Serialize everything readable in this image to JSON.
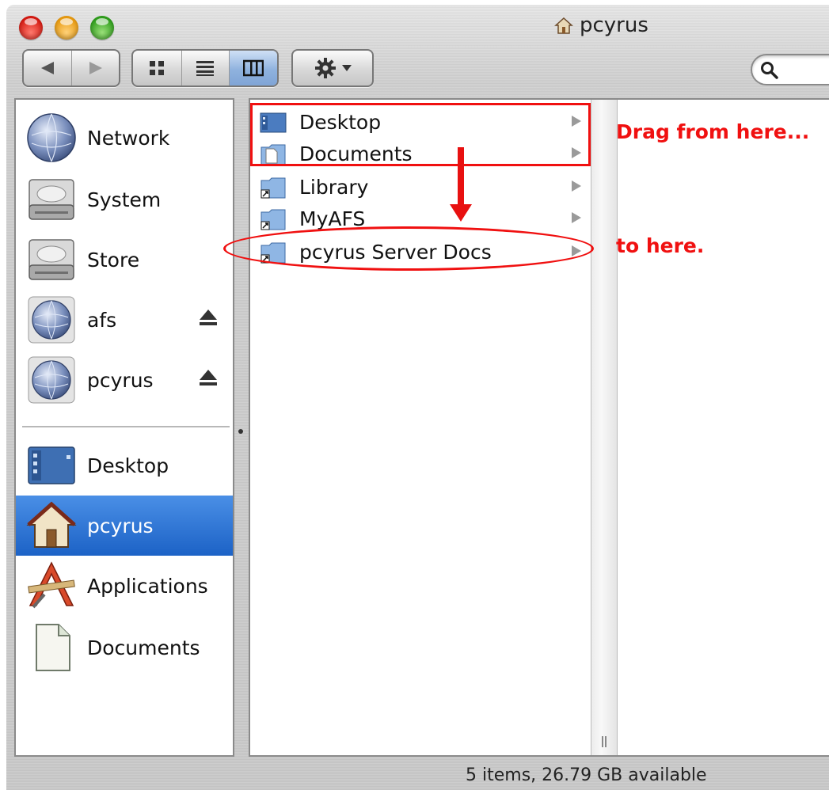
{
  "window": {
    "title": "pcyrus"
  },
  "toolbar": {
    "back": "◀",
    "forward": "▶",
    "views": [
      "icon",
      "list",
      "column"
    ],
    "active_view": "column"
  },
  "sidebar": {
    "items": [
      {
        "label": "Network",
        "icon": "network-globe-icon"
      },
      {
        "label": "System",
        "icon": "hard-drive-icon"
      },
      {
        "label": "Store",
        "icon": "hard-drive-icon"
      },
      {
        "label": "afs",
        "icon": "network-volume-icon",
        "eject": true
      },
      {
        "label": "pcyrus",
        "icon": "network-volume-icon",
        "eject": true
      },
      {
        "label": "Desktop",
        "icon": "desktop-icon"
      },
      {
        "label": "pcyrus",
        "icon": "home-icon",
        "selected": true
      },
      {
        "label": "Applications",
        "icon": "applications-icon"
      },
      {
        "label": "Documents",
        "icon": "document-icon"
      }
    ]
  },
  "browser": {
    "column1": [
      {
        "label": "Desktop",
        "icon": "desktop-folder-icon"
      },
      {
        "label": "Documents",
        "icon": "documents-folder-icon"
      },
      {
        "label": "Library",
        "icon": "alias-folder-icon"
      },
      {
        "label": "MyAFS",
        "icon": "alias-folder-icon"
      },
      {
        "label": "pcyrus Server Docs",
        "icon": "alias-folder-icon"
      }
    ]
  },
  "annotations": {
    "from": "Drag from here...",
    "to": "to here."
  },
  "status": {
    "text": "5 items, 26.79 GB available"
  },
  "colors": {
    "annotation": "#f01010",
    "selection": "#2a6fd0"
  }
}
